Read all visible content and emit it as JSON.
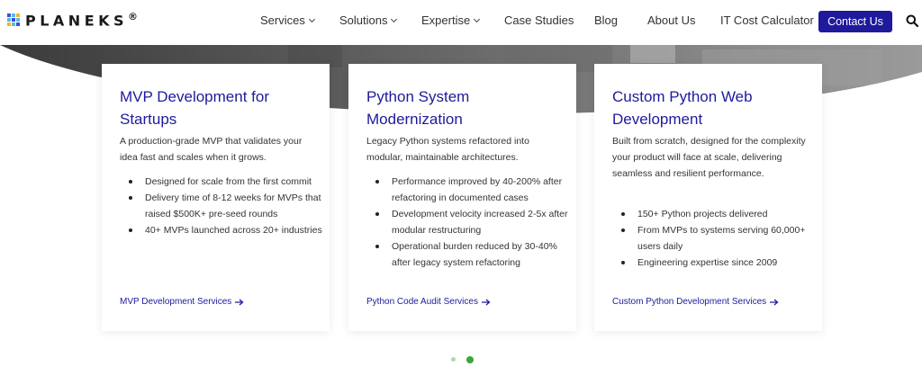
{
  "header": {
    "logo_text": "PLANEKS",
    "logo_reg": "®",
    "nav": [
      {
        "label": "Services",
        "has_caret": true
      },
      {
        "label": "Solutions",
        "has_caret": true
      },
      {
        "label": "Expertise",
        "has_caret": true
      },
      {
        "label": "Case Studies",
        "has_caret": false
      },
      {
        "label": "Blog",
        "has_caret": false
      },
      {
        "label": "About Us",
        "has_caret": false
      },
      {
        "label": "IT Cost Calculator",
        "has_caret": false
      }
    ],
    "contact_label": "Contact Us"
  },
  "cards": [
    {
      "title": "MVP Development for Startups",
      "description": "A production-grade MVP that validates your idea fast and scales when it grows.",
      "bullets": [
        "Designed for scale from the first commit",
        "Delivery time of 8-12 weeks for MVPs that raised $500K+ pre-seed rounds",
        "40+ MVPs launched across 20+ industries"
      ],
      "link": "MVP Development Services"
    },
    {
      "title": "Python System Modernization",
      "description": "Legacy Python systems refactored into modular, maintainable architectures.",
      "bullets": [
        "Performance improved by 40-200% after refactoring in documented cases",
        "Development velocity increased 2-5x after modular restructuring",
        "Operational burden reduced by 30-40% after legacy system refactoring"
      ],
      "link": "Python Code Audit Services"
    },
    {
      "title": "Custom Python Web Development",
      "description": "Built from scratch, designed for the complexity your product will face at scale, delivering seamless and resilient performance.",
      "bullets": [
        "150+ Python projects delivered",
        "From MVPs to systems serving 60,000+ users daily",
        "Engineering expertise since 2009"
      ],
      "link": "Custom Python Development Services"
    }
  ],
  "carousel": {
    "total": 2,
    "active_index": 1
  },
  "colors": {
    "brand": "#1f1a9c",
    "dot_active": "#3aa63a",
    "dot_inactive": "#a8dca8"
  },
  "icons": {
    "search": "search-icon",
    "arrow": "arrow-right-icon",
    "caret": "chevron-down-icon"
  }
}
